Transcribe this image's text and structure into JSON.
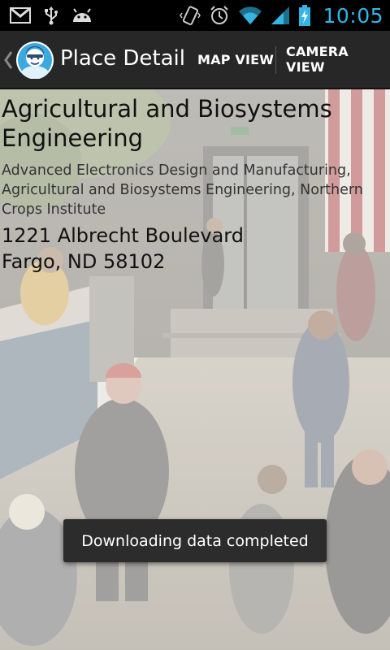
{
  "status_bar": {
    "time": "10:05",
    "left_icons": [
      "gmail-icon",
      "usb-icon",
      "android-debug-icon"
    ],
    "right_icons": [
      "vibrate-icon",
      "alarm-icon",
      "wifi-icon",
      "signal-icon",
      "battery-charging-icon"
    ],
    "accent_color": "#33b5e5"
  },
  "action_bar": {
    "title": "Place Detail",
    "actions": {
      "map_view": "MAP VIEW",
      "camera_view": "CAMERA VIEW"
    },
    "background_color": "#272727"
  },
  "place": {
    "name": "Agricultural and Biosystems Engineering",
    "departments": "Advanced Electronics Design and Manufacturing, Agricultural and Biosystems Engineering, Northern Crops Institute",
    "address_street": "1221 Albrecht Boulevard",
    "address_city": "Fargo, ND 58102"
  },
  "toast": {
    "message": "Downloading data completed"
  }
}
